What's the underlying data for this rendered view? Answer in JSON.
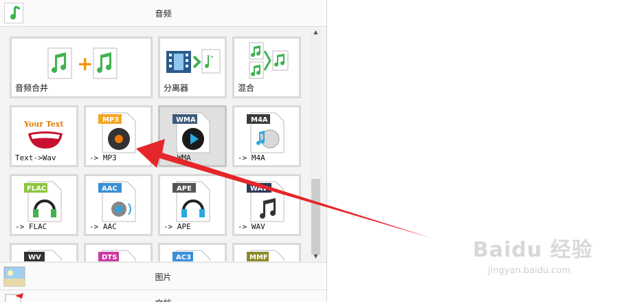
{
  "header": {
    "title": "音频"
  },
  "tiles": [
    {
      "label": "音频合并",
      "icon": "music-merge-icon"
    },
    {
      "label": "分离器",
      "icon": "video-splitter-icon"
    },
    {
      "label": "混合",
      "icon": "music-mix-icon"
    },
    {
      "label": "Text->Wav",
      "icon": "text-to-wav-icon",
      "badge": "Your Text"
    },
    {
      "label": "-> MP3",
      "icon": "mp3-file-icon",
      "badge": "MP3"
    },
    {
      "label": "-> WMA",
      "icon": "wma-file-icon",
      "badge": "WMA"
    },
    {
      "label": "-> M4A",
      "icon": "m4a-file-icon",
      "badge": "M4A"
    },
    {
      "label": "-> FLAC",
      "icon": "flac-file-icon",
      "badge": "FLAC"
    },
    {
      "label": "-> AAC",
      "icon": "aac-file-icon",
      "badge": "AAC"
    },
    {
      "label": "-> APE",
      "icon": "ape-file-icon",
      "badge": "APE"
    },
    {
      "label": "-> WAV",
      "icon": "wav-file-icon",
      "badge": "WAV"
    },
    {
      "label": "",
      "icon": "wv-file-icon",
      "badge": "WV"
    },
    {
      "label": "",
      "icon": "dts-file-icon",
      "badge": "DTS"
    },
    {
      "label": "",
      "icon": "ac3-file-icon",
      "badge": "AC3"
    },
    {
      "label": "",
      "icon": "mmf-file-icon",
      "badge": "MMF"
    }
  ],
  "categories": {
    "picture": "图片",
    "document": "文档"
  },
  "watermark": {
    "brand": "Baidu 经验",
    "url": "jingyan.baidu.com"
  },
  "colors": {
    "arrow": "#e5262b",
    "selected_tile": "#e0e0e0",
    "music_green": "#3fb34f"
  }
}
